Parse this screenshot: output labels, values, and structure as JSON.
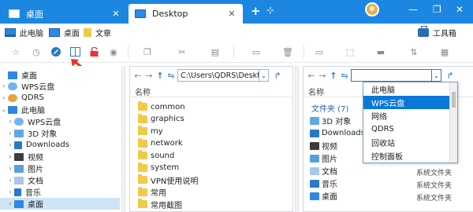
{
  "tabs": [
    {
      "label": "桌面"
    },
    {
      "label": "Desktop"
    }
  ],
  "tabbar": {
    "new_tab_glyph": "+",
    "close_glyph": "✕",
    "minimize_glyph": "—",
    "restore_glyph": "❐",
    "window_close_glyph": "✕",
    "pin_glyph": "⊹"
  },
  "quickbar": {
    "items": [
      {
        "label": "此电脑"
      },
      {
        "label": "桌面"
      },
      {
        "label": "文章"
      }
    ],
    "toolbox_label": "工具箱"
  },
  "ribbon_icons": [
    "star-icon",
    "clock-icon",
    "rocket-icon",
    "dual-pane-icon",
    "lock-icon",
    "eye-icon",
    "copy-icon",
    "cut-icon",
    "paste-icon",
    "delete-icon",
    "rename-icon",
    "pin-icon",
    "new-folder-icon",
    "sort-icon",
    "view-icon",
    "more-icon"
  ],
  "tree": {
    "items": [
      {
        "label": "桌面",
        "chev": ""
      },
      {
        "label": "WPS云盘",
        "chev": "›"
      },
      {
        "label": "QDRS",
        "chev": "›"
      },
      {
        "label": "此电脑",
        "chev": "⌄"
      },
      {
        "label": "WPS云盘",
        "chev": "›"
      },
      {
        "label": "3D 对象",
        "chev": "›"
      },
      {
        "label": "Downloads",
        "chev": "›"
      },
      {
        "label": "视频",
        "chev": "›"
      },
      {
        "label": "图片",
        "chev": "›"
      },
      {
        "label": "文档",
        "chev": "›"
      },
      {
        "label": "音乐",
        "chev": "›"
      },
      {
        "label": "桌面",
        "chev": "›"
      }
    ]
  },
  "middle_pane": {
    "address": "C:\\Users\\QDRS\\Desktop",
    "column_header": "名称",
    "files": [
      "common",
      "graphics",
      "my",
      "network",
      "sound",
      "system",
      "VPN使用说明",
      "常用",
      "常用截图"
    ]
  },
  "right_pane": {
    "address": "",
    "column_header": "名称",
    "group_label": "文件夹 (7)",
    "items": [
      {
        "label": "3D 对象"
      },
      {
        "label": "Downloads"
      },
      {
        "label": "视频"
      },
      {
        "label": "图片"
      },
      {
        "label": "文档"
      },
      {
        "label": "音乐"
      },
      {
        "label": "桌面"
      }
    ],
    "type_column": [
      "系统文件夹",
      "系统文件夹",
      "系统文件夹"
    ]
  },
  "dropdown": {
    "options": [
      "此电脑",
      "WPS云盘",
      "网络",
      "QDRS",
      "回收站",
      "控制面板"
    ],
    "highlighted_index": 1
  },
  "colors": {
    "tab_bar": "#1c87e0",
    "highlight": "#0b78d7",
    "selection": "#cfe4f7",
    "folder": "#f2c94a",
    "annotation_arrow": "#e8332c"
  }
}
